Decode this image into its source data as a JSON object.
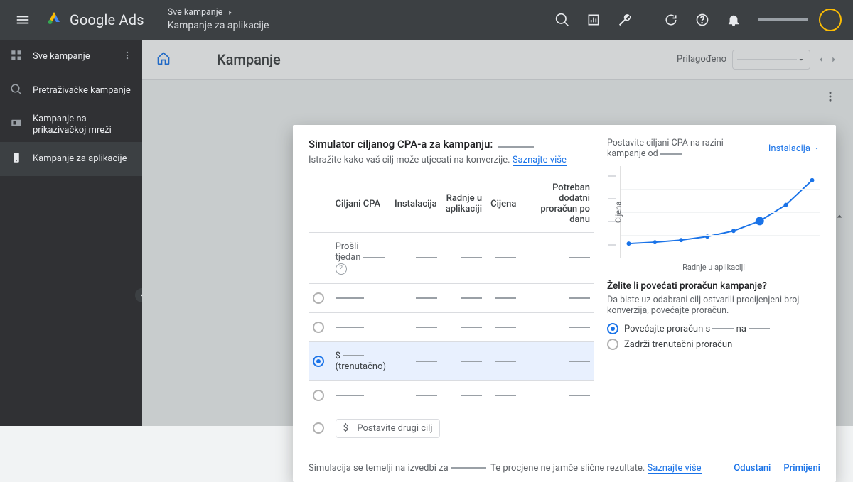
{
  "topbar": {
    "product": "Google Ads",
    "crumb_top": "Sve kampanje",
    "crumb_bottom": "Kampanje za aplikacije"
  },
  "sidebar": {
    "items": [
      {
        "label": "Sve kampanje"
      },
      {
        "label": "Pretraživačke kampanje"
      },
      {
        "label": "Kampanje na prikazivačkoj mreži"
      },
      {
        "label": "Kampanje za aplikacije"
      }
    ]
  },
  "subheader": {
    "title": "Kampanje",
    "daterange_label": "Prilagođeno"
  },
  "modal": {
    "title": "Simulator ciljanog CPA-a za kampanju:",
    "subtitle_pre": "Istražite kako vaš cilj može utjecati na konverzije.",
    "learn_more": "Saznajte više",
    "columns": {
      "target_cpa": "Ciljani CPA",
      "installs": "Instalacija",
      "in_app": "Radnje u aplikaciji",
      "cost": "Cijena",
      "extra_budget": "Potreban dodatni proračun po danu"
    },
    "past_week": "Prošli tjedan",
    "current_suffix": "(trenutačno)",
    "set_other": "Postavite drugi cilj",
    "chart": {
      "caption_pre": "Postavite ciljani CPA na razini kampanje od",
      "legend": "Instalacija",
      "ylabel": "Cijena",
      "xlabel": "Radnje u aplikaciji"
    },
    "budget_q": {
      "title": "Želite li povećati proračun kampanje?",
      "sub": "Da biste uz odabrani cilj ostvarili procijenjeni broj konverzija, povećajte proračun.",
      "opt_increase_pre": "Povećajte proračun s",
      "opt_increase_mid": "na",
      "opt_keep": "Zadrži trenutačni proračun"
    },
    "footer": {
      "text_pre": "Simulacija se temelji na izvedbi za",
      "text_post": "Te procjene ne jamče slične rezultate.",
      "learn_more": "Saznajte više",
      "cancel": "Odustani",
      "apply": "Primijeni"
    }
  },
  "chart_data": {
    "type": "line",
    "x": [
      1,
      2,
      3,
      4,
      5,
      6,
      7,
      8
    ],
    "y": [
      10,
      12,
      15,
      20,
      28,
      42,
      65,
      100
    ],
    "highlight_index": 5,
    "xlabel": "Radnje u aplikaciji",
    "ylabel": "Cijena",
    "ylim": [
      0,
      110
    ]
  }
}
